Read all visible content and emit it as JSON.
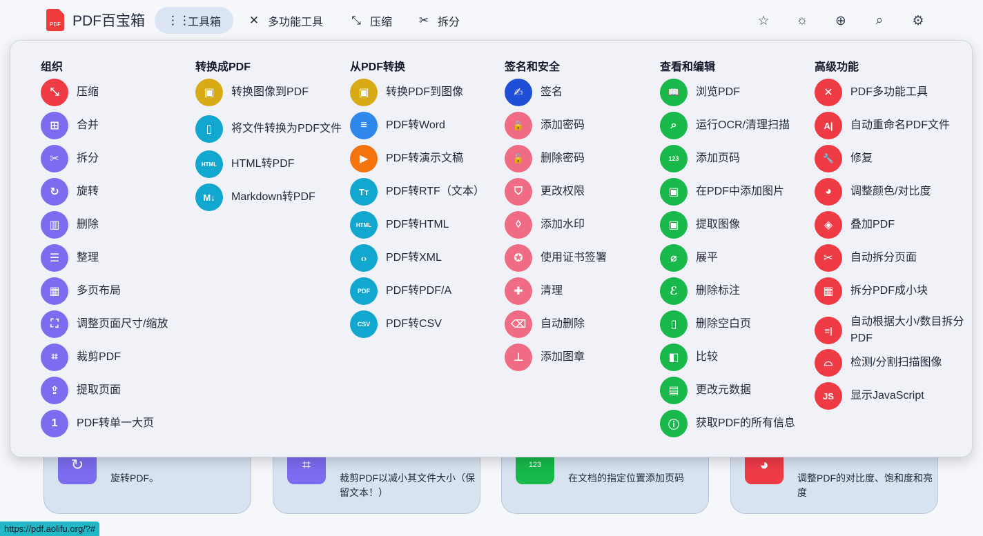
{
  "brand": {
    "name": "PDF百宝箱",
    "logo_text": "PDF"
  },
  "nav": [
    {
      "label": "工具箱",
      "icon": "grid-icon",
      "glyph": "⋮⋮"
    },
    {
      "label": "多功能工具",
      "icon": "tools-icon",
      "glyph": "✕"
    },
    {
      "label": "压缩",
      "icon": "compress-icon",
      "glyph": "⤡"
    },
    {
      "label": "拆分",
      "icon": "scissors-icon",
      "glyph": "✂"
    }
  ],
  "top_icons": [
    {
      "name": "star-icon",
      "glyph": "☆"
    },
    {
      "name": "sun-icon",
      "glyph": "☼"
    },
    {
      "name": "globe-icon",
      "glyph": "⊕"
    },
    {
      "name": "search-icon",
      "glyph": "⌕"
    },
    {
      "name": "gear-icon",
      "glyph": "⚙"
    }
  ],
  "colors": {
    "purple": "#7c6cf0",
    "red": "#ef3b46",
    "yellow": "#d8ab16",
    "blue": "#2f86eb",
    "orange": "#f5730d",
    "cyan": "#12a7cf",
    "navy": "#1f4fd6",
    "pink": "#f06b84",
    "green": "#18b84a"
  },
  "columns": [
    {
      "title": "组织",
      "items": [
        {
          "label": "压缩",
          "icon": "compress-icon",
          "glyph": "⤡",
          "color": "#ef3b46"
        },
        {
          "label": "合并",
          "icon": "merge-icon",
          "glyph": "⊞",
          "color": "#7c6cf0"
        },
        {
          "label": "拆分",
          "icon": "scissors-icon",
          "glyph": "✂",
          "color": "#7c6cf0"
        },
        {
          "label": "旋转",
          "icon": "rotate-icon",
          "glyph": "↻",
          "color": "#7c6cf0"
        },
        {
          "label": "删除",
          "icon": "trash-icon",
          "glyph": "▥",
          "color": "#7c6cf0"
        },
        {
          "label": "整理",
          "icon": "list-icon",
          "glyph": "☰",
          "color": "#7c6cf0"
        },
        {
          "label": "多页布局",
          "icon": "layout-icon",
          "glyph": "▦",
          "color": "#7c6cf0"
        },
        {
          "label": "调整页面尺寸/缩放",
          "icon": "resize-icon",
          "glyph": "⛶",
          "color": "#7c6cf0"
        },
        {
          "label": "裁剪PDF",
          "icon": "crop-icon",
          "glyph": "⌗",
          "color": "#7c6cf0"
        },
        {
          "label": "提取页面",
          "icon": "upload-icon",
          "glyph": "⇪",
          "color": "#7c6cf0"
        },
        {
          "label": "PDF转单一大页",
          "icon": "single-page-icon",
          "glyph": "1",
          "color": "#7c6cf0"
        }
      ]
    },
    {
      "title": "转换成PDF",
      "items": [
        {
          "label": "转换图像到PDF",
          "icon": "image-icon",
          "glyph": "▣",
          "color": "#d8ab16"
        },
        {
          "label": "将文件转换为PDF文件",
          "icon": "file-icon",
          "glyph": "▯",
          "color": "#12a7cf"
        },
        {
          "label": "HTML转PDF",
          "icon": "html-icon",
          "glyph": "HTML",
          "color": "#12a7cf"
        },
        {
          "label": "Markdown转PDF",
          "icon": "markdown-icon",
          "glyph": "M↓",
          "color": "#12a7cf"
        }
      ]
    },
    {
      "title": "从PDF转换",
      "items": [
        {
          "label": "转换PDF到图像",
          "icon": "image-icon",
          "glyph": "▣",
          "color": "#d8ab16"
        },
        {
          "label": "PDF转Word",
          "icon": "word-icon",
          "glyph": "≡",
          "color": "#2f86eb"
        },
        {
          "label": "PDF转演示文稿",
          "icon": "slides-icon",
          "glyph": "▶",
          "color": "#f5730d"
        },
        {
          "label": "PDF转RTF（文本）",
          "icon": "text-icon",
          "glyph": "Tт",
          "color": "#12a7cf"
        },
        {
          "label": "PDF转HTML",
          "icon": "html-icon",
          "glyph": "HTML",
          "color": "#12a7cf"
        },
        {
          "label": "PDF转XML",
          "icon": "code-icon",
          "glyph": "‹›",
          "color": "#12a7cf"
        },
        {
          "label": "PDF转PDF/A",
          "icon": "pdfa-icon",
          "glyph": "PDF",
          "color": "#12a7cf"
        },
        {
          "label": "PDF转CSV",
          "icon": "csv-icon",
          "glyph": "CSV",
          "color": "#12a7cf"
        }
      ]
    },
    {
      "title": "签名和安全",
      "items": [
        {
          "label": "签名",
          "icon": "signature-icon",
          "glyph": "✍",
          "color": "#1f4fd6"
        },
        {
          "label": "添加密码",
          "icon": "lock-icon",
          "glyph": "🔒",
          "color": "#f06b84"
        },
        {
          "label": "删除密码",
          "icon": "unlock-icon",
          "glyph": "🔓",
          "color": "#f06b84"
        },
        {
          "label": "更改权限",
          "icon": "shield-icon",
          "glyph": "⛉",
          "color": "#f06b84"
        },
        {
          "label": "添加水印",
          "icon": "droplet-icon",
          "glyph": "◊",
          "color": "#f06b84"
        },
        {
          "label": "使用证书签署",
          "icon": "certificate-icon",
          "glyph": "✪",
          "color": "#f06b84"
        },
        {
          "label": "清理",
          "icon": "sanitize-icon",
          "glyph": "✚",
          "color": "#f06b84"
        },
        {
          "label": "自动删除",
          "icon": "eraser-icon",
          "glyph": "⌫",
          "color": "#f06b84"
        },
        {
          "label": "添加图章",
          "icon": "stamp-icon",
          "glyph": "⊥",
          "color": "#f06b84"
        }
      ]
    },
    {
      "title": "查看和编辑",
      "items": [
        {
          "label": "浏览PDF",
          "icon": "book-icon",
          "glyph": "📖",
          "color": "#18b84a"
        },
        {
          "label": "运行OCR/清理扫描",
          "icon": "ocr-icon",
          "glyph": "⌕",
          "color": "#18b84a"
        },
        {
          "label": "添加页码",
          "icon": "numbers-icon",
          "glyph": "123",
          "color": "#18b84a"
        },
        {
          "label": "在PDF中添加图片",
          "icon": "add-image-icon",
          "glyph": "▣",
          "color": "#18b84a"
        },
        {
          "label": "提取图像",
          "icon": "image-icon",
          "glyph": "▣",
          "color": "#18b84a"
        },
        {
          "label": "展平",
          "icon": "flatten-icon",
          "glyph": "⌀",
          "color": "#18b84a"
        },
        {
          "label": "删除标注",
          "icon": "annotation-icon",
          "glyph": "ℰ",
          "color": "#18b84a"
        },
        {
          "label": "删除空白页",
          "icon": "blank-page-icon",
          "glyph": "▯",
          "color": "#18b84a"
        },
        {
          "label": "比较",
          "icon": "compare-icon",
          "glyph": "◧",
          "color": "#18b84a"
        },
        {
          "label": "更改元数据",
          "icon": "metadata-icon",
          "glyph": "▤",
          "color": "#18b84a"
        },
        {
          "label": "获取PDF的所有信息",
          "icon": "info-icon",
          "glyph": "ⓘ",
          "color": "#18b84a"
        }
      ]
    },
    {
      "title": "高级功能",
      "items": [
        {
          "label": "PDF多功能工具",
          "icon": "tools-icon",
          "glyph": "✕",
          "color": "#ef3b46"
        },
        {
          "label": "自动重命名PDF文件",
          "icon": "rename-icon",
          "glyph": "A|",
          "color": "#ef3b46"
        },
        {
          "label": "修复",
          "icon": "wrench-icon",
          "glyph": "🔧",
          "color": "#ef3b46"
        },
        {
          "label": "调整颜色/对比度",
          "icon": "palette-icon",
          "glyph": "◕",
          "color": "#ef3b46"
        },
        {
          "label": "叠加PDF",
          "icon": "layers-icon",
          "glyph": "◈",
          "color": "#ef3b46"
        },
        {
          "label": "自动拆分页面",
          "icon": "scissors-icon",
          "glyph": "✂",
          "color": "#ef3b46"
        },
        {
          "label": "拆分PDF成小块",
          "icon": "grid-icon",
          "glyph": "▦",
          "color": "#ef3b46"
        },
        {
          "label": "自动根据大小/数目拆分PDF",
          "icon": "split-size-icon",
          "glyph": "≡|",
          "color": "#ef3b46"
        },
        {
          "label": "检测/分割扫描图像",
          "icon": "scanner-icon",
          "glyph": "⌓",
          "color": "#ef3b46"
        },
        {
          "label": "显示JavaScript",
          "icon": "javascript-icon",
          "glyph": "JS",
          "color": "#ef3b46"
        }
      ]
    }
  ],
  "bg_cards": [
    {
      "desc": "旋转PDF。",
      "icon": "rotate-icon",
      "glyph": "↻",
      "color": "#7c6cf0"
    },
    {
      "desc": "裁剪PDF以减小其文件大小（保留文本！）",
      "icon": "crop-icon",
      "glyph": "⌗",
      "color": "#7c6cf0"
    },
    {
      "desc": "在文档的指定位置添加页码",
      "icon": "numbers-icon",
      "glyph": "123",
      "color": "#18b84a"
    },
    {
      "desc": "调整PDF的对比度、饱和度和亮度",
      "icon": "palette-icon",
      "glyph": "◕",
      "color": "#ef3b46"
    }
  ],
  "status_url": "https://pdf.aolifu.org/?#"
}
